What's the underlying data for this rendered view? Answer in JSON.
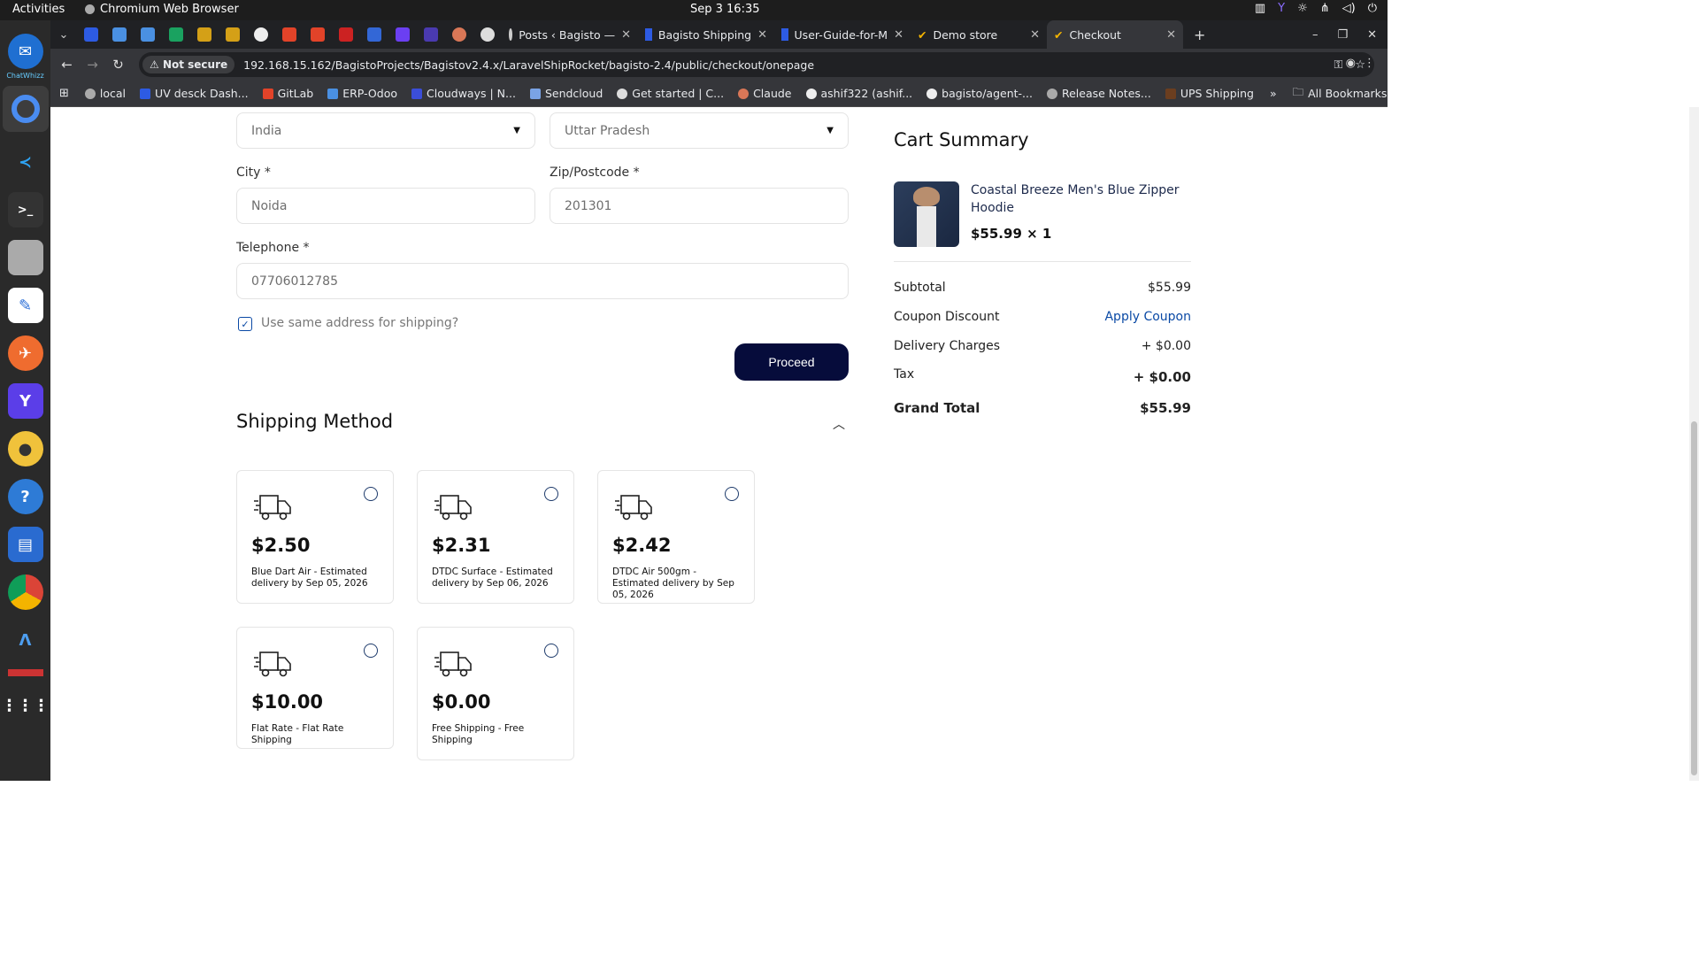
{
  "os": {
    "activities": "Activities",
    "app_name": "Chromium Web Browser",
    "clock": "Sep 3  16:35",
    "dock_label": "ChatWhizz"
  },
  "browser": {
    "tabs": [
      {
        "label": "Posts ‹ Bagisto —"
      },
      {
        "label": "Bagisto Shipping"
      },
      {
        "label": "User-Guide-for-M"
      },
      {
        "label": "Demo store"
      },
      {
        "label": "Checkout"
      }
    ],
    "not_secure": "Not secure",
    "url": "192.168.15.162/BagistoProjects/Bagistov2.4.x/LaravelShipRocket/bagisto-2.4/public/checkout/onepage",
    "bookmarks": [
      "local",
      "UV desck Dash...",
      "GitLab",
      "ERP-Odoo",
      "Cloudways | N...",
      "Sendcloud",
      "Get started | C...",
      "Claude",
      "ashif322 (ashif...",
      "bagisto/agent-...",
      "Release Notes...",
      "UPS Shipping"
    ],
    "all_bookmarks": "All Bookmarks"
  },
  "form": {
    "country": "India",
    "state": "Uttar Pradesh",
    "city_label": "City *",
    "city": "Noida",
    "zip_label": "Zip/Postcode *",
    "zip": "201301",
    "phone_label": "Telephone *",
    "phone": "07706012785",
    "same_address": "Use same address for shipping?",
    "proceed": "Proceed"
  },
  "shipping": {
    "title": "Shipping Method",
    "methods": [
      {
        "price": "$2.50",
        "desc": "Blue Dart Air - Estimated delivery by Sep 05, 2026"
      },
      {
        "price": "$2.31",
        "desc": "DTDC Surface - Estimated delivery by Sep 06, 2026"
      },
      {
        "price": "$2.42",
        "desc": "DTDC Air 500gm - Estimated delivery by Sep 05, 2026"
      },
      {
        "price": "$10.00",
        "desc": "Flat Rate - Flat Rate Shipping"
      },
      {
        "price": "$0.00",
        "desc": "Free Shipping - Free Shipping"
      }
    ]
  },
  "cart": {
    "title": "Cart Summary",
    "product_name": "Coastal Breeze Men's Blue Zipper Hoodie",
    "product_price": "$55.99 × 1",
    "subtotal_label": "Subtotal",
    "subtotal": "$55.99",
    "coupon_label": "Coupon Discount",
    "coupon_link": "Apply Coupon",
    "delivery_label": "Delivery Charges",
    "delivery": "+ $0.00",
    "tax_label": "Tax",
    "tax": "+ $0.00",
    "total_label": "Grand Total",
    "total": "$55.99"
  }
}
